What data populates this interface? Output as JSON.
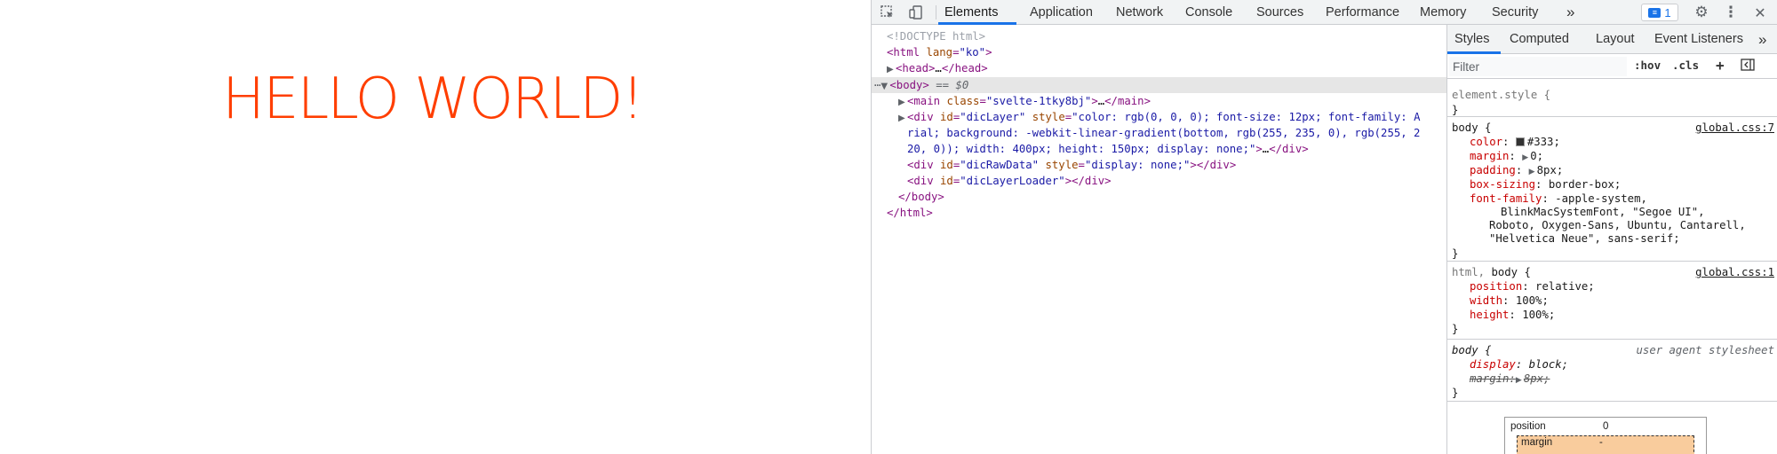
{
  "page": {
    "heading": "HELLO WORLD!",
    "heading_color": "#ff3e00"
  },
  "devtools": {
    "toolbar": {
      "tabs": [
        "Elements",
        "Application",
        "Network",
        "Console",
        "Sources",
        "Performance",
        "Memory",
        "Security"
      ],
      "more_glyph": "»",
      "messages_count": "1",
      "accent_color": "#1a73e8"
    },
    "dom": {
      "doctype": "<!DOCTYPE html>",
      "html_open_tag": "<html",
      "html_lang_attr": "lang",
      "html_lang_val": "\"ko\"",
      "gt": ">",
      "head_open": "<head>",
      "ellipsis": "…",
      "head_close": "</head>",
      "body_open": "<body>",
      "selected_marker": "== $0",
      "main_tag": "<main",
      "main_attr": "class",
      "main_val": "\"svelte-1tky8bj\"",
      "main_close": "</main>",
      "div_tag": "<div",
      "div_close": "</div>",
      "id_attr": "id",
      "style_attr": "style",
      "diclayer_id": "\"dicLayer\"",
      "diclayer_style_1": "\"color: rgb(0, 0, 0); font-size: 12px; font-family: A",
      "diclayer_style_2": "rial; background: -webkit-linear-gradient(bottom, rgb(255, 235, 0), rgb(255, 2",
      "diclayer_style_3": "20, 0)); width: 400px; height: 150px; display: none;\"",
      "dicrawdata_id": "\"dicRawData\"",
      "dicrawdata_style": "\"display: none;\"",
      "diclayerloader_id": "\"dicLayerLoader\"",
      "body_close": "</body>",
      "html_close": "</html>"
    },
    "styles": {
      "subtabs": [
        "Styles",
        "Computed",
        "Layout",
        "Event Listeners"
      ],
      "more_glyph": "»",
      "filter_placeholder": "Filter",
      "hov": ":hov",
      "cls": ".cls",
      "plus": "+",
      "element_style_selector": "element.style {",
      "close_brace": "}",
      "rule_body_selector": "body {",
      "rule_body_source": "global.css:7",
      "body_props": [
        {
          "name": "color",
          "value": "#333;"
        },
        {
          "name": "margin",
          "value": "0;"
        },
        {
          "name": "padding",
          "value": "8px;"
        },
        {
          "name": "box-sizing",
          "value": "border-box;"
        },
        {
          "name": "font-family",
          "value": "-apple-system,"
        }
      ],
      "font_family_cont": [
        "BlinkMacSystemFont, \"Segoe UI\",",
        "Roboto, Oxygen-Sans, Ubuntu, Cantarell,",
        "\"Helvetica Neue\", sans-serif;"
      ],
      "rule_html_selector_a": "html,",
      "rule_html_selector_b": "body {",
      "rule_html_source": "global.css:1",
      "html_props": [
        {
          "name": "position",
          "value": "relative;"
        },
        {
          "name": "width",
          "value": "100%;"
        },
        {
          "name": "height",
          "value": "100%;"
        }
      ],
      "ua_selector": "body {",
      "ua_source": "user agent stylesheet",
      "ua_props": [
        {
          "name": "display",
          "value": "block;"
        },
        {
          "name": "margin",
          "value": "8px;"
        }
      ],
      "colon": ":",
      "box_model": {
        "position_label": "position",
        "position_value": "0",
        "margin_label": "margin",
        "margin_value": "-"
      }
    }
  }
}
